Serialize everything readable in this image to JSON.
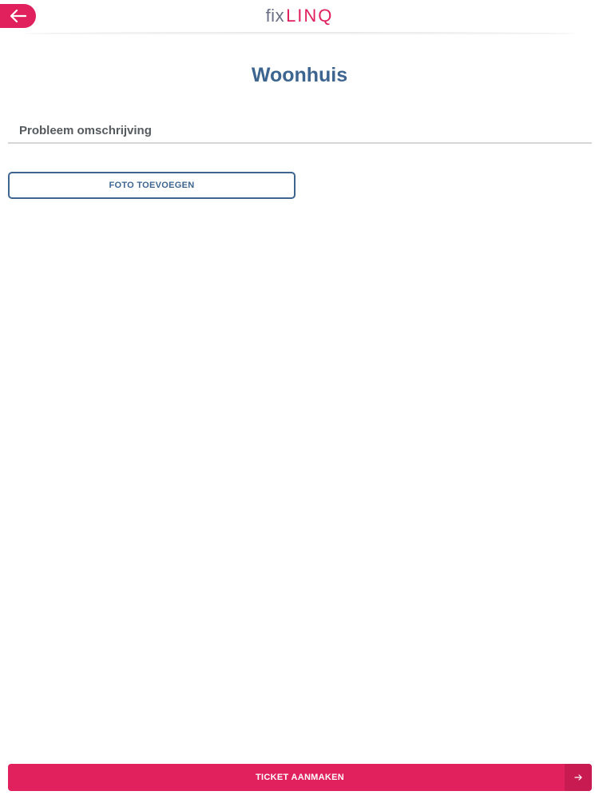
{
  "header": {
    "logo_part1": "fix",
    "logo_part2": "LINQ",
    "back_icon": "arrow-left-icon"
  },
  "page": {
    "title": "Woonhuis"
  },
  "form": {
    "description_placeholder": "Probleem omschrijving",
    "description_value": "",
    "add_photo_label": "FOTO TOEVOEGEN"
  },
  "footer": {
    "create_ticket_label": "TICKET AANMAKEN",
    "arrow_icon": "arrow-right-icon"
  },
  "colors": {
    "brand_pink": "#e0215d",
    "brand_blue": "#3d6590",
    "text_gray": "#555a5e"
  }
}
